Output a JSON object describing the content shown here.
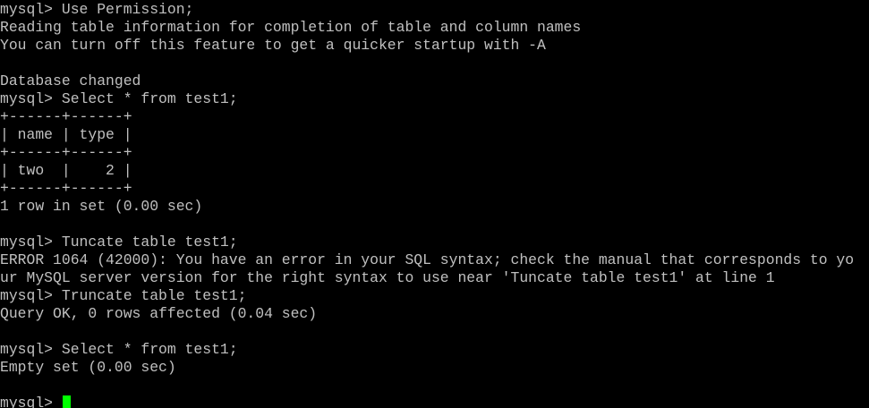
{
  "terminal": {
    "lines": [
      "mysql> Use Permission;",
      "Reading table information for completion of table and column names",
      "You can turn off this feature to get a quicker startup with -A",
      "",
      "Database changed",
      "mysql> Select * from test1;",
      "+------+------+",
      "| name | type |",
      "+------+------+",
      "| two  |    2 |",
      "+------+------+",
      "1 row in set (0.00 sec)",
      "",
      "mysql> Tuncate table test1;",
      "ERROR 1064 (42000): You have an error in your SQL syntax; check the manual that corresponds to yo",
      "ur MySQL server version for the right syntax to use near 'Tuncate table test1' at line 1",
      "mysql> Truncate table test1;",
      "Query OK, 0 rows affected (0.04 sec)",
      "",
      "mysql> Select * from test1;",
      "Empty set (0.00 sec)",
      ""
    ],
    "prompt": "mysql> ",
    "cursor_color": "#00ff00",
    "text_color": "#c0c0c0",
    "background_color": "#000000"
  }
}
